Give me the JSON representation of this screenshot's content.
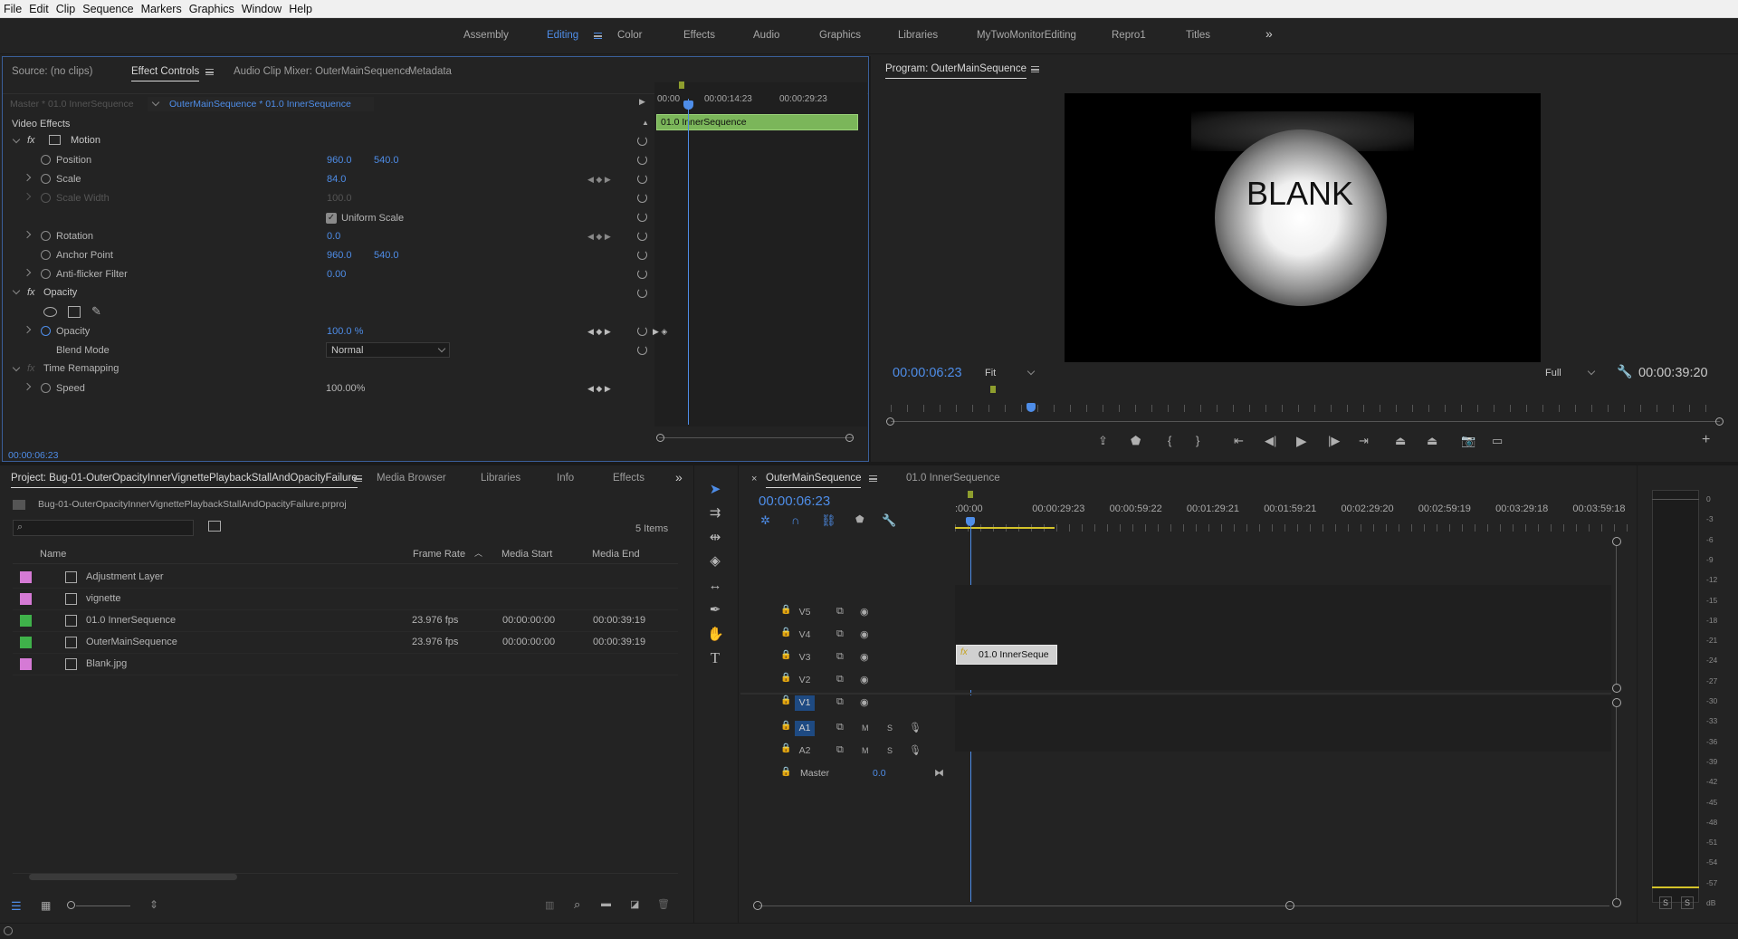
{
  "menu": [
    "File",
    "Edit",
    "Clip",
    "Sequence",
    "Markers",
    "Graphics",
    "Window",
    "Help"
  ],
  "workspaces": [
    {
      "label": "Assembly",
      "active": false
    },
    {
      "label": "Editing",
      "active": true
    },
    {
      "label": "Color",
      "active": false
    },
    {
      "label": "Effects",
      "active": false
    },
    {
      "label": "Audio",
      "active": false
    },
    {
      "label": "Graphics",
      "active": false
    },
    {
      "label": "Libraries",
      "active": false
    },
    {
      "label": "MyTwoMonitorEditing",
      "active": false
    },
    {
      "label": "Repro1",
      "active": false
    },
    {
      "label": "Titles",
      "active": false
    }
  ],
  "effect_panel": {
    "tabs": [
      "Source: (no clips)",
      "Effect Controls",
      "Audio Clip Mixer: OuterMainSequence",
      "Metadata"
    ],
    "master_label": "Master * 01.0 InnerSequence",
    "clip_label": "OuterMainSequence * 01.0 InnerSequence",
    "ruler": [
      "00:00",
      "00:00:14:23",
      "00:00:29:23"
    ],
    "clip_bar": "01.0 InnerSequence",
    "section": "Video Effects",
    "motion": "Motion",
    "position_label": "Position",
    "position_x": "960.0",
    "position_y": "540.0",
    "scale_label": "Scale",
    "scale": "84.0",
    "scale_width_label": "Scale Width",
    "scale_width": "100.0",
    "uniform_scale": "Uniform Scale",
    "rotation_label": "Rotation",
    "rotation": "0.0",
    "anchor_label": "Anchor Point",
    "anchor_x": "960.0",
    "anchor_y": "540.0",
    "antiflicker_label": "Anti-flicker Filter",
    "antiflicker": "0.00",
    "opacity_group": "Opacity",
    "opacity_label": "Opacity",
    "opacity": "100.0 %",
    "blend_label": "Blend Mode",
    "blend": "Normal",
    "time_remap": "Time Remapping",
    "speed_label": "Speed",
    "speed": "100.00%",
    "timecode": "00:00:06:23"
  },
  "program": {
    "title": "Program: OuterMainSequence",
    "frame_text": "BLANK",
    "timecode": "00:00:06:23",
    "fit": "Fit",
    "quality": "Full",
    "duration": "00:00:39:20"
  },
  "project": {
    "tabs": [
      "Project: Bug-01-OuterOpacityInnerVignettePlaybackStallAndOpacityFailure",
      "Media Browser",
      "Libraries",
      "Info",
      "Effects"
    ],
    "file": "Bug-01-OuterOpacityInnerVignettePlaybackStallAndOpacityFailure.prproj",
    "items_count": "5 Items",
    "columns": [
      "Name",
      "Frame Rate",
      "Media Start",
      "Media End"
    ],
    "rows": [
      {
        "name": "Adjustment Layer",
        "fps": "",
        "start": "",
        "end": "",
        "color": "#d57ad5"
      },
      {
        "name": "vignette",
        "fps": "",
        "start": "",
        "end": "",
        "color": "#d57ad5"
      },
      {
        "name": "01.0 InnerSequence",
        "fps": "23.976 fps",
        "start": "00:00:00:00",
        "end": "00:00:39:19",
        "color": "#3fb24a"
      },
      {
        "name": "OuterMainSequence",
        "fps": "23.976 fps",
        "start": "00:00:00:00",
        "end": "00:00:39:19",
        "color": "#3fb24a"
      },
      {
        "name": "Blank.jpg",
        "fps": "",
        "start": "",
        "end": "",
        "color": "#d57ad5"
      }
    ]
  },
  "timeline": {
    "tabs": [
      "OuterMainSequence",
      "01.0 InnerSequence"
    ],
    "timecode": "00:00:06:23",
    "ruler": [
      ":00:00",
      "00:00:29:23",
      "00:00:59:22",
      "00:01:29:21",
      "00:01:59:21",
      "00:02:29:20",
      "00:02:59:19",
      "00:03:29:18",
      "00:03:59:18"
    ],
    "video_tracks": [
      "V5",
      "V4",
      "V3",
      "V2",
      "V1"
    ],
    "audio_tracks": [
      "A1",
      "A2"
    ],
    "master_label": "Master",
    "master_value": "0.0",
    "clip_label": "01.0 InnerSeque"
  },
  "meter": {
    "ticks": [
      "0",
      "-3",
      "-6",
      "-9",
      "-12",
      "-15",
      "-18",
      "-21",
      "-24",
      "-27",
      "-30",
      "-33",
      "-36",
      "-39",
      "-42",
      "-45",
      "-48",
      "-51",
      "-54",
      "-57",
      "dB"
    ],
    "solo": [
      "S",
      "S"
    ]
  },
  "colors": {
    "accent": "#4e8de8",
    "clip_green": "#7bb65a",
    "bg": "#232323"
  }
}
